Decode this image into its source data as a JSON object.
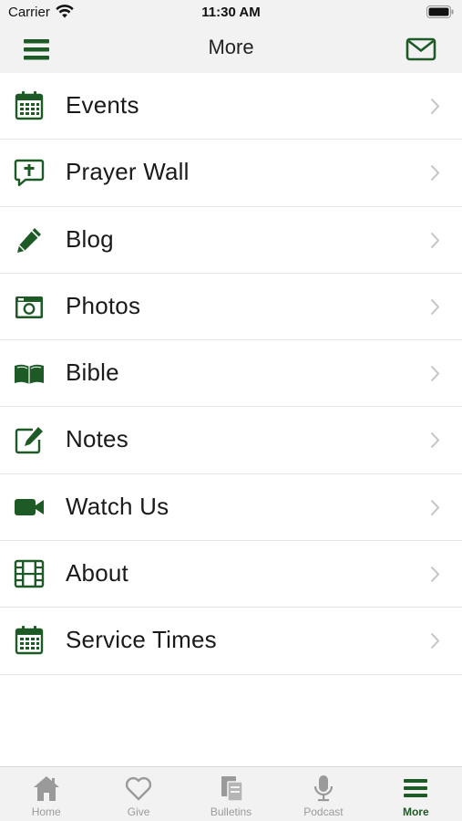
{
  "status_bar": {
    "carrier": "Carrier",
    "time": "11:30 AM"
  },
  "nav": {
    "title": "More",
    "left_icon": "menu-icon",
    "right_icon": "mail-icon"
  },
  "menu": {
    "items": [
      {
        "label": "Events",
        "icon": "calendar-icon"
      },
      {
        "label": "Prayer Wall",
        "icon": "prayer-bubble-icon"
      },
      {
        "label": "Blog",
        "icon": "pencil-icon"
      },
      {
        "label": "Photos",
        "icon": "camera-icon"
      },
      {
        "label": "Bible",
        "icon": "book-icon"
      },
      {
        "label": "Notes",
        "icon": "edit-note-icon"
      },
      {
        "label": "Watch Us",
        "icon": "video-camera-icon"
      },
      {
        "label": "About",
        "icon": "film-icon"
      },
      {
        "label": "Service Times",
        "icon": "calendar-icon"
      }
    ]
  },
  "tabs": [
    {
      "label": "Home",
      "icon": "home-icon",
      "active": false
    },
    {
      "label": "Give",
      "icon": "heart-icon",
      "active": false
    },
    {
      "label": "Bulletins",
      "icon": "bulletins-icon",
      "active": false
    },
    {
      "label": "Podcast",
      "icon": "microphone-icon",
      "active": false
    },
    {
      "label": "More",
      "icon": "menu-icon",
      "active": true
    }
  ],
  "colors": {
    "accent": "#1d5a26",
    "tab_inactive": "#9a9a9a",
    "bar_background": "#f2f2f2",
    "divider": "#e6e6e6"
  }
}
